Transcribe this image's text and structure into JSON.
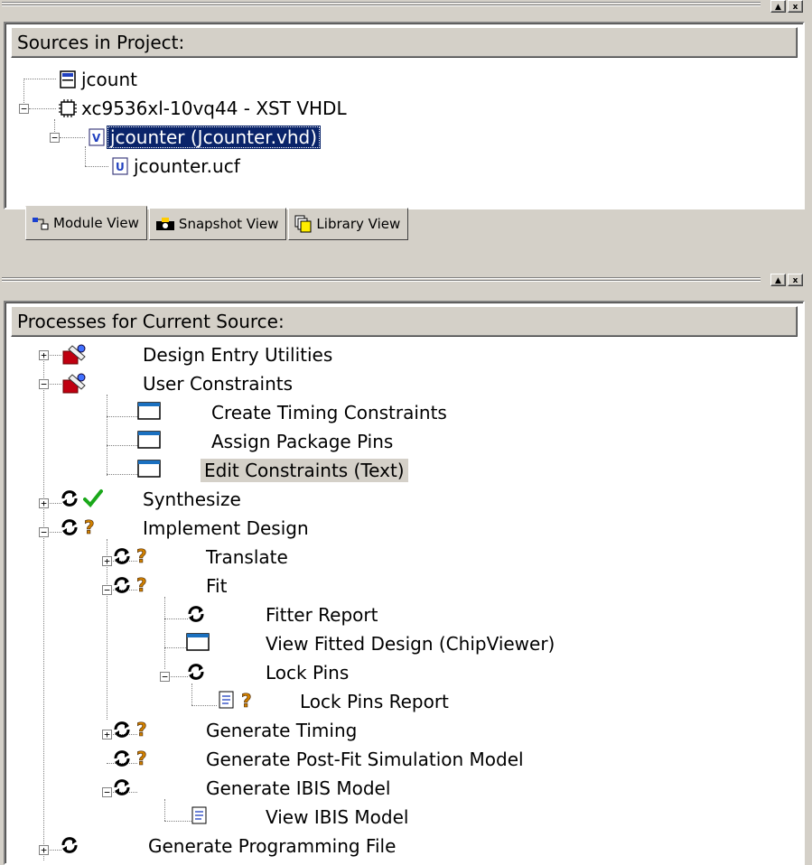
{
  "top_toolbar": {
    "min_glyph": "▲",
    "close_glyph": "x"
  },
  "sources": {
    "title": "Sources in Project:",
    "items": [
      {
        "label": "jcount",
        "icon": "project-icon"
      },
      {
        "label": "xc9536xl-10vq44 - XST VHDL",
        "icon": "chip-icon"
      },
      {
        "label": "jcounter (Jcounter.vhd)",
        "icon": "vhdl-file-icon",
        "selected": true
      },
      {
        "label": "jcounter.ucf",
        "icon": "ucf-file-icon"
      }
    ]
  },
  "tabs": [
    {
      "label": "Module View",
      "icon": "module-view-icon",
      "active": true
    },
    {
      "label": "Snapshot View",
      "icon": "camera-icon",
      "active": false
    },
    {
      "label": "Library View",
      "icon": "library-icon",
      "active": false
    }
  ],
  "processes": {
    "title": "Processes for Current Source:",
    "items": [
      {
        "label": "Design Entry Utilities",
        "icon": "tools-icon"
      },
      {
        "label": "User Constraints",
        "icon": "tools-icon"
      },
      {
        "label": "Create Timing Constraints",
        "icon": "window-icon"
      },
      {
        "label": "Assign Package Pins",
        "icon": "window-icon"
      },
      {
        "label": "Edit Constraints (Text)",
        "icon": "window-icon",
        "highlighted": true
      },
      {
        "label": "Synthesize",
        "icon": "run-icon",
        "status": "check-icon"
      },
      {
        "label": "Implement Design",
        "icon": "run-icon",
        "status": "question-icon"
      },
      {
        "label": "Translate",
        "icon": "run-icon",
        "status": "question-icon"
      },
      {
        "label": "Fit",
        "icon": "run-icon",
        "status": "question-icon"
      },
      {
        "label": "Fitter Report",
        "icon": "run-icon"
      },
      {
        "label": "View Fitted Design (ChipViewer)",
        "icon": "window-icon"
      },
      {
        "label": "Lock Pins",
        "icon": "run-icon"
      },
      {
        "label": "Lock Pins Report",
        "icon": "report-icon",
        "status": "question-icon"
      },
      {
        "label": "Generate Timing",
        "icon": "run-icon",
        "status": "question-icon"
      },
      {
        "label": "Generate Post-Fit Simulation Model",
        "icon": "run-icon",
        "status": "question-icon"
      },
      {
        "label": "Generate IBIS Model",
        "icon": "run-icon"
      },
      {
        "label": "View IBIS Model",
        "icon": "report-icon"
      },
      {
        "label": "Generate Programming File",
        "icon": "run-icon"
      }
    ]
  },
  "colors": {
    "selection": "#0a246a",
    "chrome": "#d4d0c8",
    "check": "#1aa81a",
    "question": "#d08000"
  }
}
